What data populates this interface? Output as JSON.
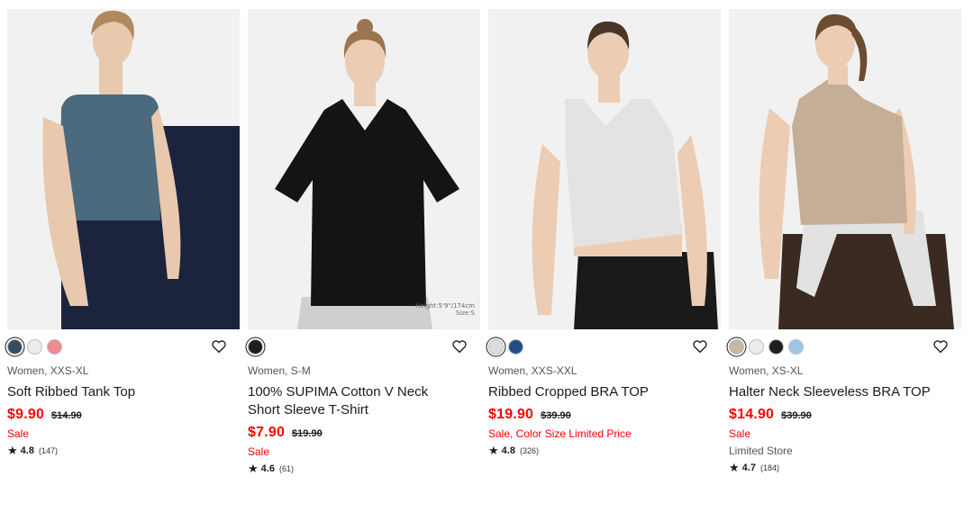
{
  "products": [
    {
      "swatches": [
        "#364c5f",
        "#ececec",
        "#f08a8e"
      ],
      "selected_swatch": 0,
      "meta": "Women, XXS-XL",
      "name": "Soft Ribbed Tank Top",
      "price": "$9.90",
      "original_price": "$14.90",
      "sale": "Sale",
      "rating": "4.8",
      "review_count": "(147)",
      "garment_color": "#4b6a7d",
      "bottom_color": "#1c243d"
    },
    {
      "swatches": [
        "#1e1e1e"
      ],
      "selected_swatch": 0,
      "meta": "Women, S-M",
      "name": "100% SUPIMA Cotton V Neck Short Sleeve T-Shirt",
      "price": "$7.90",
      "original_price": "$19.90",
      "sale": "Sale",
      "rating": "4.6",
      "review_count": "(61)",
      "height_note_line1": "Height:5'9\"/174cm",
      "height_note_line2": "Size:S",
      "garment_color": "#141414",
      "bottom_color": "#cfcfcf"
    },
    {
      "swatches": [
        "#dcdcdc",
        "#204e8a"
      ],
      "selected_swatch": 0,
      "meta": "Women, XXS-XXL",
      "name": "Ribbed Cropped BRA TOP",
      "price": "$19.90",
      "original_price": "$39.90",
      "sale": "Sale, Color Size Limited Price",
      "rating": "4.8",
      "review_count": "(326)",
      "garment_color": "#e3e3e3",
      "bottom_color": "#1a1a1a"
    },
    {
      "swatches": [
        "#c9b7a6",
        "#ececec",
        "#1e1e1e",
        "#9fc6e6"
      ],
      "selected_swatch": 0,
      "meta": "Women, XS-XL",
      "name": "Halter Neck Sleeveless BRA TOP",
      "price": "$14.90",
      "original_price": "$39.90",
      "sale": "Sale",
      "store": "Limited Store",
      "rating": "4.7",
      "review_count": "(184)",
      "garment_color": "#c4ae97",
      "bottom_color": "#3a2a22"
    }
  ],
  "icons": {
    "favorite": "heart-outline-icon",
    "star": "star-icon"
  },
  "colors": {
    "sale_red": "#ff0000",
    "text": "#1b1b1b",
    "meta": "#555555",
    "photo_bg": "#f1f1f1"
  }
}
